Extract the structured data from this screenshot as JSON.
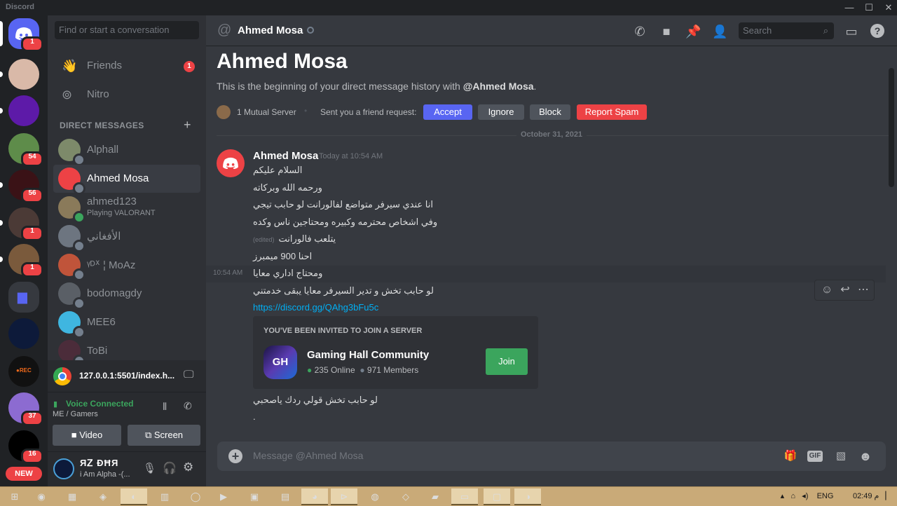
{
  "window": {
    "app_name": "Discord",
    "controls": [
      "—",
      "☐",
      "✕"
    ]
  },
  "rail": {
    "home_badge": "1",
    "servers": [
      {
        "name": "server-baby",
        "color": "#d9b9a8",
        "badge": null,
        "dot": true
      },
      {
        "name": "server-purple",
        "color": "#5d1aa8",
        "badge": null,
        "dot": true
      },
      {
        "name": "server-landscape",
        "color": "#5e8c4a",
        "badge": "54",
        "dot": false
      },
      {
        "name": "server-dark-red",
        "color": "#3a1216",
        "badge": "56",
        "dot": true
      },
      {
        "name": "server-portrait",
        "color": "#4b3a36",
        "badge": "1",
        "dot": true
      },
      {
        "name": "server-avatar",
        "color": "#7a5a3c",
        "badge": "1",
        "dot": true
      },
      {
        "name": "server-folder",
        "color": "#2f3136",
        "badge": null,
        "dot": false
      },
      {
        "name": "server-valorant",
        "color": "#0d1a3a",
        "badge": null,
        "dot": false
      },
      {
        "name": "server-rec",
        "color": "#111111",
        "badge": null,
        "dot": false
      },
      {
        "name": "server-anime",
        "color": "#8c6bd1",
        "badge": "37",
        "dot": false
      },
      {
        "name": "server-ghost",
        "color": "#000000",
        "badge": "16",
        "dot": false
      }
    ],
    "new_label": "NEW"
  },
  "sidebar": {
    "search_placeholder": "Find or start a conversation",
    "friends_label": "Friends",
    "friends_badge": "1",
    "nitro_label": "Nitro",
    "dm_header": "DIRECT MESSAGES",
    "dms": [
      {
        "name": "Alphall",
        "sub": "",
        "color": "#7d8a6a",
        "status": "#747f8d",
        "active": false
      },
      {
        "name": "Ahmed Mosa",
        "sub": "",
        "color": "#ed4245",
        "status": "#747f8d",
        "active": true
      },
      {
        "name": "ahmed123",
        "sub": "Playing VALORANT",
        "color": "#8a7a5a",
        "status": "#3ba55d",
        "active": false
      },
      {
        "name": "الأفغاني",
        "sub": "",
        "color": "#6d7580",
        "status": "#747f8d",
        "active": false
      },
      {
        "name": "ᵞᴰᕁ ¦ MoAz",
        "sub": "",
        "color": "#c0543a",
        "status": "#747f8d",
        "active": false
      },
      {
        "name": "bodomagdy",
        "sub": "",
        "color": "#5a5f66",
        "status": "#747f8d",
        "active": false
      },
      {
        "name": "MEE6",
        "sub": "",
        "color": "#3fb6e0",
        "status": "#747f8d",
        "active": false
      },
      {
        "name": "ToBi",
        "sub": "",
        "color": "#4b2c3a",
        "status": "#747f8d",
        "active": false
      }
    ],
    "stream_title": "127.0.0.1:5501/index.h...",
    "voice_status": "Voice Connected",
    "voice_channel": "ME / Gamers",
    "video_label": "Video",
    "screen_label": "Screen",
    "user_name": "ЯᏃ ÐĦЯ",
    "user_status": "i Am Alpha -(..."
  },
  "header": {
    "name": "Ahmed Mosa",
    "search_placeholder": "Search"
  },
  "intro": {
    "title": "Ahmed Mosa",
    "text_prefix": "This is the beginning of your direct message history with ",
    "text_handle": "@Ahmed Mosa",
    "text_suffix": ".",
    "mutual": "1 Mutual Server",
    "request": "Sent you a friend request:",
    "accept": "Accept",
    "ignore": "Ignore",
    "block": "Block",
    "report": "Report Spam"
  },
  "divider_date": "October 31, 2021",
  "message": {
    "author": "Ahmed Mosa",
    "timestamp": "Today at 10:54 AM",
    "hover_time": "10:54 AM",
    "lines": [
      "السلام عليكم",
      "ورحمه الله وبركاته",
      "انا عندي سيرفر متواضع لفالورانت لو حابب تيجي",
      "وفي اشخاص محترمه وكبيره ومحتاجين ناس وكده",
      "يتلعب فالورانت",
      "احنا 900 ميمبرز",
      "ومحتاج اداري معايا",
      "لو حابب تخش و تدير السيرفر معايا يبقى خدمتني"
    ],
    "edited_label": "(edited)",
    "link": "https://discord.gg/QAhg3bFu5c",
    "after": [
      "لو حابب تخش قولي ردك ياصحبي",
      "."
    ]
  },
  "invite": {
    "caption": "YOU'VE BEEN INVITED TO JOIN A SERVER",
    "icon_text": "GH",
    "server": "Gaming Hall Community",
    "online": "235 Online",
    "members": "971 Members",
    "join": "Join"
  },
  "composer": {
    "placeholder": "Message @Ahmed Mosa",
    "gif": "GIF"
  },
  "taskbar": {
    "lang": "ENG",
    "time": "02:49",
    "ampm": "م"
  },
  "colors": {
    "blurple": "#5865f2",
    "red": "#ed4245",
    "green": "#3ba55d",
    "link": "#00aff4"
  }
}
